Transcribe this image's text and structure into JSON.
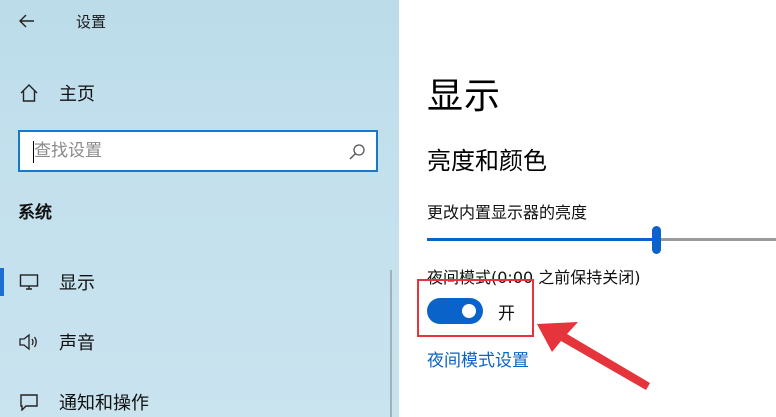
{
  "window": {
    "title": "设置"
  },
  "sidebar": {
    "home_label": "主页",
    "search": {
      "placeholder": "查找设置",
      "value": ""
    },
    "section_heading": "系统",
    "items": [
      {
        "label": "显示",
        "icon": "monitor-icon",
        "active": true
      },
      {
        "label": "声音",
        "icon": "speaker-icon",
        "active": false
      },
      {
        "label": "通知和操作",
        "icon": "notification-icon",
        "active": false
      }
    ]
  },
  "main": {
    "page_title": "显示",
    "section_title": "亮度和颜色",
    "brightness": {
      "label": "更改内置显示器的亮度",
      "value_fraction": 0.64
    },
    "night_light": {
      "label": "夜间模式(0:00 之前保持关闭)",
      "toggle_state": "开",
      "toggle_on": true,
      "settings_link": "夜间模式设置"
    }
  },
  "colors": {
    "accent": "#0a63c9",
    "annotation_red": "#e5343b",
    "sidebar_bg": "#c3e0ed"
  }
}
